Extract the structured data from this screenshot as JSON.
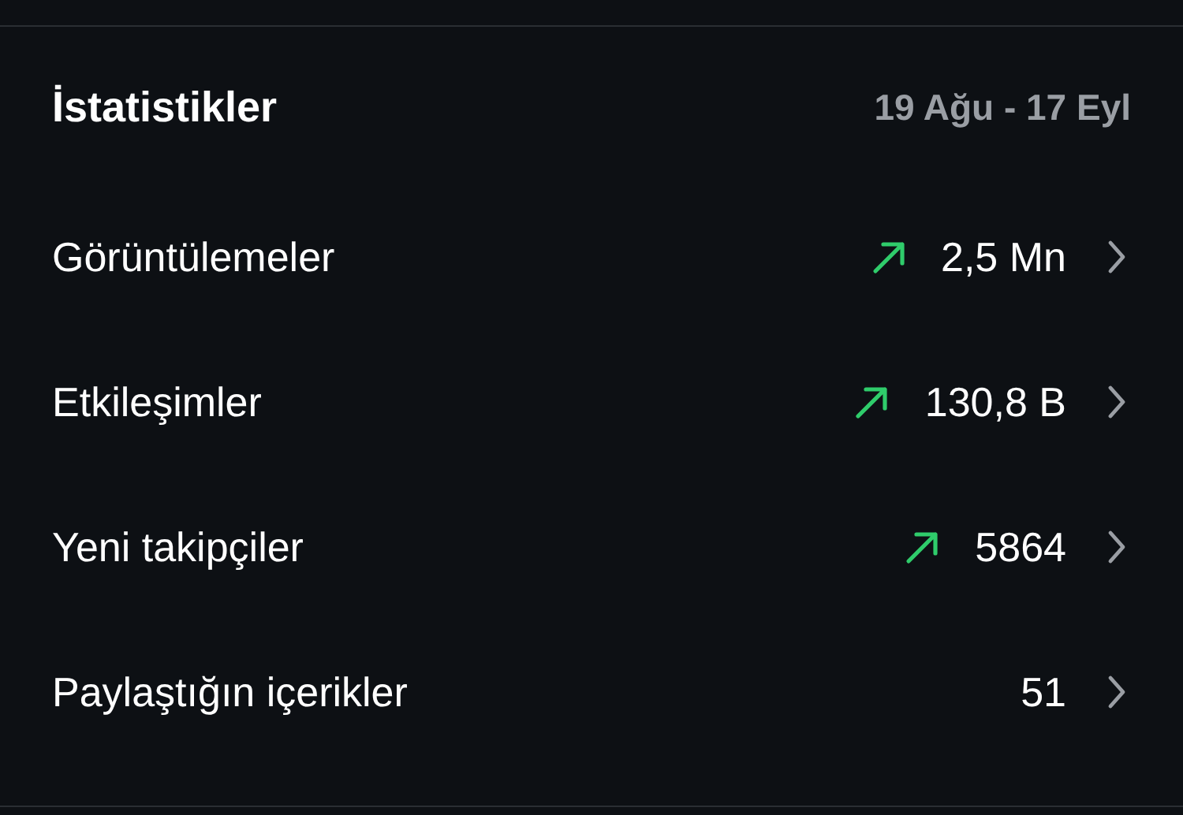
{
  "header": {
    "title": "İstatistikler",
    "date_range": "19 Ağu - 17 Eyl"
  },
  "rows": [
    {
      "label": "Görüntülemeler",
      "value": "2,5 Mn",
      "trending_up": true
    },
    {
      "label": "Etkileşimler",
      "value": "130,8 B",
      "trending_up": true
    },
    {
      "label": "Yeni takipçiler",
      "value": "5864",
      "trending_up": true
    },
    {
      "label": "Paylaştığın içerikler",
      "value": "51",
      "trending_up": false
    }
  ]
}
